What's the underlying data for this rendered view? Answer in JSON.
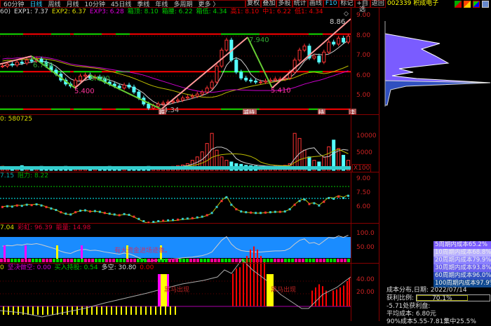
{
  "toolbar": {
    "items": [
      "60分钟",
      "日线",
      "周线",
      "月线",
      "10分钟",
      "45日线",
      "季线",
      "年线",
      "多周期",
      "更多 〉"
    ],
    "active": "日线",
    "right": [
      "复权",
      "叠加",
      "多股",
      "统计",
      "画线",
      "F10",
      "标记",
      "+自选",
      "返回"
    ]
  },
  "stock": {
    "code": "002339",
    "name": "积成电子"
  },
  "main": {
    "prefix": "60)",
    "exp1": "EXP1: 7.37",
    "exp2": "EXP2: 6.37",
    "exp3": "EXP3: 6.28",
    "box_top": "箱顶: 8.10",
    "box_mid": "箱腰: 6.22",
    "box_low": "箱低: 4.34",
    "high1": "高1: 8.10",
    "mid1": "中1: 6.22",
    "low1": "低1: 4.34",
    "ticks": [
      "9.00",
      "8.00",
      "7.00",
      "6.00",
      "5.00"
    ],
    "labels": {
      "p1": "6.780",
      "p2": "5.400",
      "p3": "6.060",
      "p4": "4.34",
      "p5": "7.940",
      "p6": "5.410",
      "p7": "8.86"
    },
    "markers": [
      "跌",
      "减持",
      "持",
      "卖"
    ],
    "zigzag": [
      [
        0,
        6.6
      ],
      [
        45,
        7.0
      ],
      [
        107,
        5.4
      ],
      [
        128,
        6.06
      ],
      [
        230,
        4.34
      ],
      [
        353,
        7.94
      ],
      [
        388,
        5.41
      ],
      [
        500,
        8.86
      ]
    ],
    "closes": [
      6.5,
      6.6,
      6.55,
      6.7,
      6.65,
      6.8,
      6.75,
      6.85,
      6.7,
      6.5,
      6.3,
      6.1,
      5.8,
      5.6,
      5.5,
      5.8,
      6.0,
      6.05,
      5.9,
      5.95,
      5.85,
      5.7,
      5.6,
      5.5,
      5.4,
      5.55,
      5.45,
      5.2,
      4.9,
      4.6,
      4.4,
      4.5,
      4.6,
      4.65,
      4.7,
      4.75,
      4.8,
      4.9,
      4.95,
      5.0,
      5.1,
      5.2,
      5.4,
      5.7,
      6.5,
      7.3,
      7.8,
      6.8,
      6.2,
      5.9,
      5.8,
      5.75,
      5.7,
      5.7,
      5.75,
      5.8,
      5.85,
      5.85,
      5.9,
      6.2,
      6.8,
      7.3,
      7.5,
      6.9,
      7.0,
      6.7,
      7.2,
      7.7,
      7.6,
      7.9,
      7.7,
      8.0
    ]
  },
  "volume": {
    "label": "0: 580725",
    "ticks": [
      "10000",
      "5000"
    ],
    "unit": "X100",
    "values": [
      12,
      10,
      11,
      9,
      14,
      10,
      9,
      11,
      12,
      10,
      9,
      11,
      10,
      12,
      11,
      10,
      9,
      8,
      10,
      11,
      9,
      10,
      12,
      11,
      10,
      9,
      10,
      11,
      9,
      10,
      12,
      10,
      11,
      9,
      10,
      12,
      14,
      16,
      20,
      30,
      40,
      55,
      80,
      110,
      60,
      40,
      30,
      25,
      20,
      18,
      15,
      14,
      13,
      12,
      11,
      12,
      13,
      14,
      15,
      20,
      110,
      95,
      60,
      40,
      30,
      25,
      40,
      70,
      90,
      65,
      45,
      30
    ]
  },
  "ind3": {
    "v1": "7.15",
    "v2": "阻力: 8.22",
    "ticks": [
      "9.00",
      "7.50",
      "6.00"
    ]
  },
  "ind4": {
    "v1": "7.04",
    "v2": "彩虹: 96.39",
    "v3": "能量: 14.98",
    "note": "有大资金进场迹象。",
    "ticks": [
      "100.0",
      "50.00"
    ]
  },
  "ind5": {
    "v0": "0",
    "v1": "坚决做空: 0.00",
    "v2": "买入持股: 0.54",
    "v3": "多空: 30.80",
    "v4": "0.00",
    "note": "黑马出现",
    "ticks": [
      "40.00",
      "20.00"
    ]
  },
  "chips": {
    "legend": [
      "5周期内成本65.2%",
      "10周期内成本68.8%",
      "20周期内成本79.9%",
      "30周期内成本93.8%",
      "60周期内成本96.0%",
      "100周期内成本97.9%"
    ],
    "legend_colors": [
      "#7a5cff",
      "#b8b0ff",
      "#8a80ff",
      "#6a60f0",
      "#3050c0",
      "#104a90"
    ],
    "date": "成本分布,日期: 2022/07/14",
    "profit_label": "获利比例:",
    "profit": "70.1%",
    "profit_value": 70.1,
    "line3": "-5.71处获利盘:",
    "avg": "平均成本: 6.80元",
    "line5": "90%成本5.55-7.81集中25.5%"
  }
}
